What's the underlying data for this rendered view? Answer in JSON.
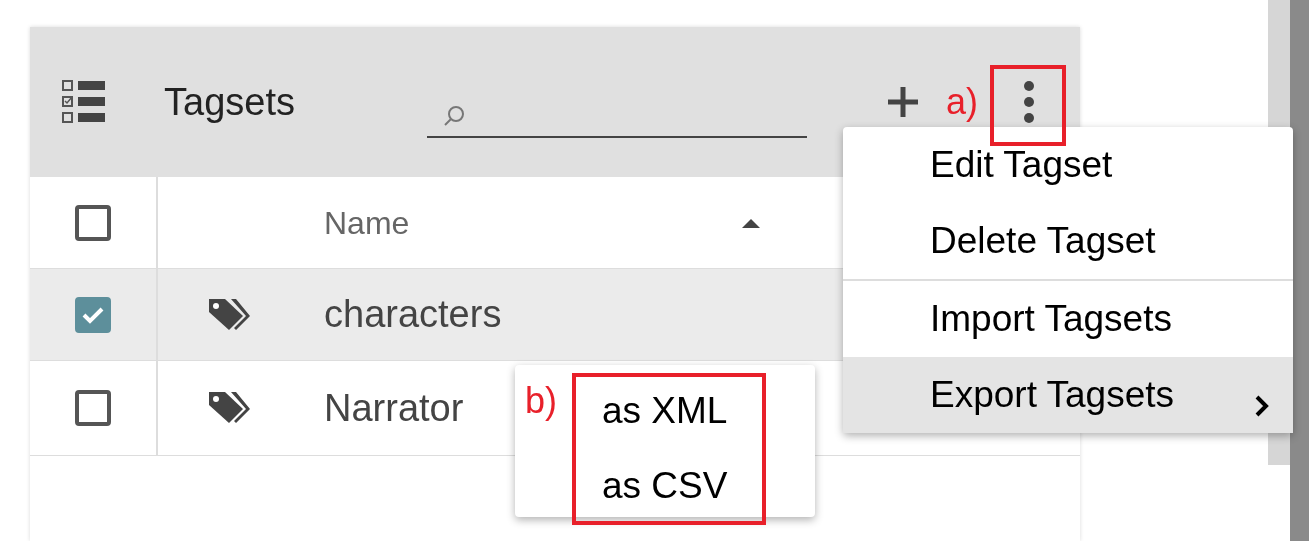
{
  "header": {
    "title": "Tagsets",
    "annotation": "a)"
  },
  "table": {
    "select_all": {
      "checked": false
    },
    "columns": [
      {
        "label": "Name",
        "sorted_ascending": true
      }
    ],
    "rows": [
      {
        "checked": true,
        "selected": true,
        "name": "characters"
      },
      {
        "checked": false,
        "selected": false,
        "name": "Narrator"
      }
    ]
  },
  "menu": {
    "items": [
      {
        "label": "Edit Tagset",
        "highlighted": false,
        "divider_before": false,
        "has_submenu": false
      },
      {
        "label": "Delete Tagset",
        "highlighted": false,
        "divider_before": false,
        "has_submenu": false
      },
      {
        "label": "Import Tagsets",
        "highlighted": false,
        "divider_before": true,
        "has_submenu": false
      },
      {
        "label": "Export Tagsets",
        "highlighted": true,
        "divider_before": false,
        "has_submenu": true
      }
    ]
  },
  "submenu": {
    "annotation": "b)",
    "items": [
      {
        "label": "as XML"
      },
      {
        "label": "as CSV"
      }
    ]
  }
}
